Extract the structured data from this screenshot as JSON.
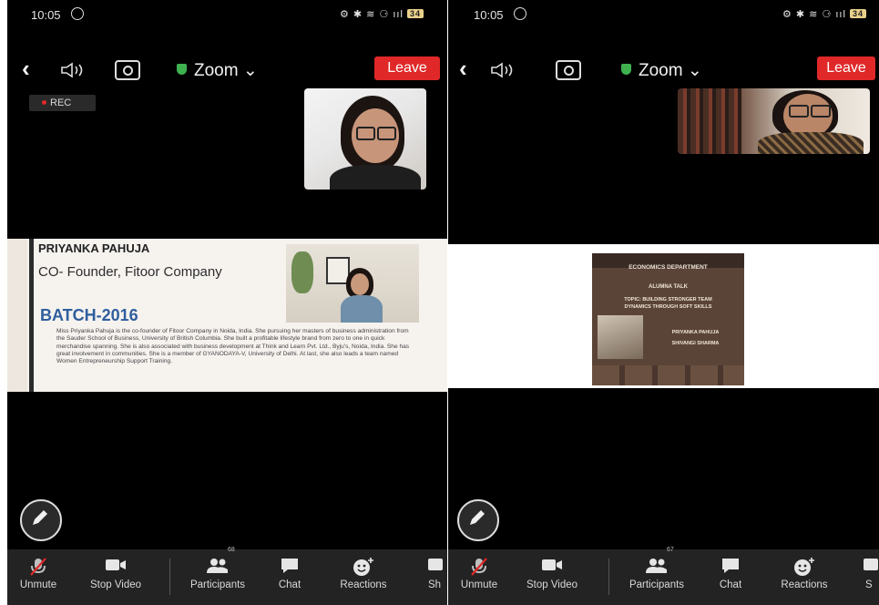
{
  "panels": [
    {
      "status": {
        "time": "10:05",
        "battery": "34",
        "icons": "⚙ ✱ ≋ ⚆ ııl"
      },
      "topbar": {
        "meeting": "Zoom ⌄",
        "leave": "Leave"
      },
      "rec": "REC",
      "shared": {
        "name": "PRIYANKA PAHUJA",
        "role": "CO- Founder, Fitoor Company",
        "batch": "BATCH-2016",
        "bio": "Miss Priyanka Pahuja is the co-founder of Fitoor Company in Noida, India. She pursuing her masters of business administration from the Sauder School of Business, University of British Columbia. She built a profitable lifestyle brand from zero to one in quick merchandise spanning. She is also associated with business development at Think and Learn Pvt. Ltd., Byju's, Noida, India. She has great involvement in communities. She is a member of GYANODAYA-V, University of Delhi. At last, she also leads a team named Women Entrepreneurship Support Training."
      },
      "toolbar": {
        "unmute": "Unmute",
        "stop_video": "Stop Video",
        "participants": "Participants",
        "participants_count": "68",
        "chat": "Chat",
        "reactions": "Reactions",
        "share": "Sh"
      }
    },
    {
      "status": {
        "time": "10:05",
        "battery": "34",
        "icons": "⚙ ✱ ≋ ⚆ ııl"
      },
      "topbar": {
        "meeting": "Zoom ⌄",
        "leave": "Leave"
      },
      "shared": {
        "poster_lines": [
          "ECONOMICS DEPARTMENT",
          "ALUMNA TALK",
          "TOPIC: BUILDING STRONGER TEAM",
          "DYNAMICS THROUGH SOFT SKILLS",
          "PRIYANKA PAHUJA",
          "SHIVANGI SHARMA"
        ]
      },
      "toolbar": {
        "unmute": "Unmute",
        "stop_video": "Stop Video",
        "participants": "Participants",
        "participants_count": "67",
        "chat": "Chat",
        "reactions": "Reactions",
        "share": "S"
      }
    }
  ],
  "colors": {
    "leave": "#e02828",
    "shield": "#3fb24f",
    "batch": "#2f5e9e",
    "toolbar": "#232323"
  }
}
